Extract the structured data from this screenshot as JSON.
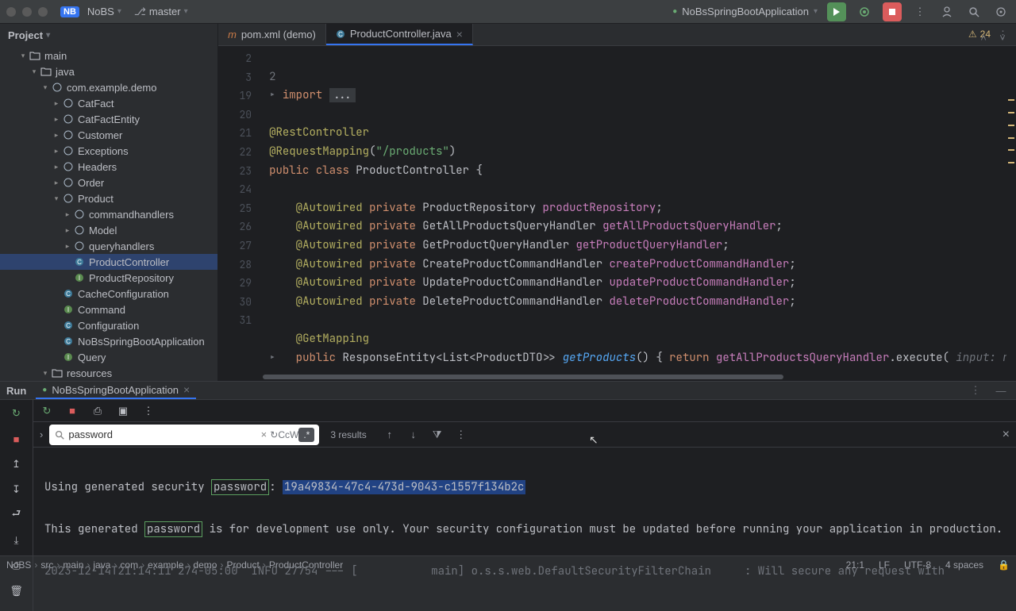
{
  "topbar": {
    "project_badge": "NB",
    "project_name": "NoBS",
    "branch": "master",
    "run_config": "NoBsSpringBootApplication"
  },
  "sidebar": {
    "title": "Project",
    "tree": [
      {
        "indent": 1,
        "chev": "▾",
        "icon": "folder",
        "label": "main"
      },
      {
        "indent": 2,
        "chev": "▾",
        "icon": "folder",
        "label": "java"
      },
      {
        "indent": 3,
        "chev": "▾",
        "icon": "pkg",
        "label": "com.example.demo"
      },
      {
        "indent": 4,
        "chev": "▸",
        "icon": "pkg",
        "label": "CatFact"
      },
      {
        "indent": 4,
        "chev": "▸",
        "icon": "pkg",
        "label": "CatFactEntity"
      },
      {
        "indent": 4,
        "chev": "▸",
        "icon": "pkg",
        "label": "Customer"
      },
      {
        "indent": 4,
        "chev": "▸",
        "icon": "pkg",
        "label": "Exceptions"
      },
      {
        "indent": 4,
        "chev": "▸",
        "icon": "pkg",
        "label": "Headers"
      },
      {
        "indent": 4,
        "chev": "▸",
        "icon": "pkg",
        "label": "Order"
      },
      {
        "indent": 4,
        "chev": "▾",
        "icon": "pkg",
        "label": "Product"
      },
      {
        "indent": 5,
        "chev": "▸",
        "icon": "pkg",
        "label": "commandhandlers"
      },
      {
        "indent": 5,
        "chev": "▸",
        "icon": "pkg",
        "label": "Model"
      },
      {
        "indent": 5,
        "chev": "▸",
        "icon": "pkg",
        "label": "queryhandlers"
      },
      {
        "indent": 5,
        "chev": "",
        "icon": "class",
        "label": "ProductController",
        "selected": true
      },
      {
        "indent": 5,
        "chev": "",
        "icon": "iface",
        "label": "ProductRepository"
      },
      {
        "indent": 4,
        "chev": "",
        "icon": "class",
        "label": "CacheConfiguration"
      },
      {
        "indent": 4,
        "chev": "",
        "icon": "iface",
        "label": "Command"
      },
      {
        "indent": 4,
        "chev": "",
        "icon": "class",
        "label": "Configuration"
      },
      {
        "indent": 4,
        "chev": "",
        "icon": "class",
        "label": "NoBsSpringBootApplication"
      },
      {
        "indent": 4,
        "chev": "",
        "icon": "iface",
        "label": "Query"
      },
      {
        "indent": 3,
        "chev": "▾",
        "icon": "folder",
        "label": "resources"
      }
    ]
  },
  "tabs": [
    {
      "icon": "m",
      "label": "pom.xml (demo)",
      "active": false
    },
    {
      "icon": "c",
      "label": "ProductController.java",
      "active": true
    }
  ],
  "problems": {
    "count": "24"
  },
  "gutter_start": 2,
  "gutter_lines": [
    "2",
    "3",
    "",
    "19",
    "20",
    "21",
    "22",
    "23",
    "24",
    "25",
    "26",
    "27",
    "28",
    "29",
    "30",
    "31",
    ""
  ],
  "code": {
    "l3_import": "import",
    "l3_dots": "...",
    "l19": "@RestController",
    "l20a": "@RequestMapping",
    "l20b": "(",
    "l20c": "\"/products\"",
    "l20d": ")",
    "l21a": "public",
    "l21b": "class",
    "l21c": "ProductController",
    "l21d": "{",
    "aw": "@Autowired",
    "priv": "private",
    "t23": "ProductRepository",
    "f23": "productRepository",
    "t24": "GetAllProductsQueryHandler",
    "f24": "getAllProductsQueryHandler",
    "t25": "GetProductQueryHandler",
    "f25": "getProductQueryHandler",
    "t26": "CreateProductCommandHandler",
    "f26": "createProductCommandHandler",
    "t27": "UpdateProductCommandHandler",
    "f27": "updateProductCommandHandler",
    "t28": "DeleteProductCommandHandler",
    "f28": "deleteProductCommandHandler",
    "l30": "@GetMapping",
    "l31a": "public",
    "l31b": "ResponseEntity<List<ProductDTO>>",
    "l31c": "getProducts",
    "l31d": "()",
    "l31e": "{",
    "l31f": "return",
    "l31g": "getAllProductsQueryHandler",
    "l31h": ".execute(",
    "l31i": "input:",
    "l31j": "nu"
  },
  "run": {
    "tab": "Run",
    "config_tab": "NoBsSpringBootApplication",
    "find": {
      "value": "password",
      "results": "3 results",
      "cc": "Cc",
      "w": "W",
      "regex": ".*"
    },
    "console": {
      "line1a": "Using generated security ",
      "line1_hl": "password",
      "line1b": ": ",
      "line1_sel": "19a49834-47c4-473d-9043-c1557f134b2c",
      "line2a": "This generated ",
      "line2_hl": "password",
      "line2b": " is for development use only. Your security configuration must be updated before running your application in production.",
      "line3": "2023-12-14T21:14:11 274-05:00  INFO 27754 --- [           main] o.s.s.web.DefaultSecurityFilterChain     : Will secure any request with"
    }
  },
  "status": {
    "crumbs": [
      "NoBS",
      "src",
      "main",
      "java",
      "com",
      "example",
      "demo",
      "Product",
      "ProductController"
    ],
    "ln": "21:1",
    "le": "LF",
    "enc": "UTF-8",
    "indent": "4 spaces"
  }
}
